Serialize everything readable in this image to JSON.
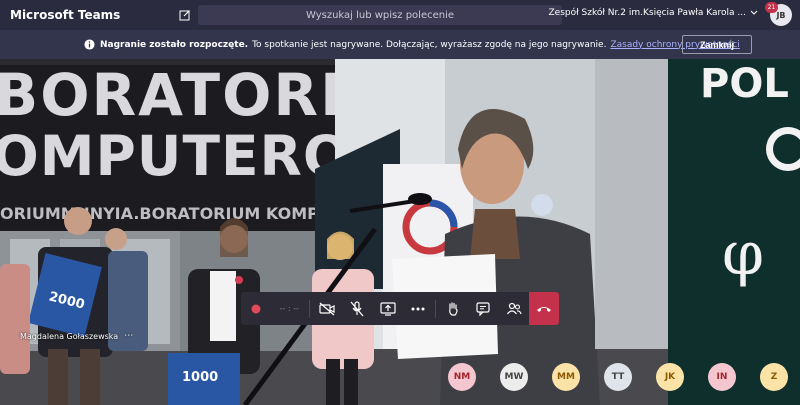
{
  "app": {
    "title": "Microsoft Teams"
  },
  "topbar": {
    "search_placeholder": "Wyszukaj lub wpisz polecenie",
    "org_name": "Zespół Szkół Nr.2 im.Księcia Pawła Karola ...",
    "notification_count": "21",
    "user_initials": "JB"
  },
  "banner": {
    "bold_text": "Nagranie zostało rozpoczęte.",
    "message": "To spotkanie jest nagrywane. Dołączając, wyrażasz zgodę na jego nagrywanie.",
    "link_text": "Zasady ochrony prywatności",
    "close_label": "Zamknij"
  },
  "video": {
    "wall_line1": "BORATORIUM",
    "wall_line2": "OMPUTEROWE",
    "wall_line3": "ORIUMMUNYIA.BORATORIUM KOMPUTEROWE  TEROWE",
    "right_banner_text": "POL",
    "speaker_name": "Magdalena Gołaszewska",
    "more_label": "⋯",
    "placard_left": "2000",
    "placard_bottom": "1000"
  },
  "controls": {
    "timer_text": "-- : --"
  },
  "participants": [
    {
      "initials": "NM",
      "bg": "#f4c6cf",
      "fg": "#a4262c"
    },
    {
      "initials": "MW",
      "bg": "#ececec",
      "fg": "#444"
    },
    {
      "initials": "MM",
      "bg": "#fbe3a8",
      "fg": "#8a5a00"
    },
    {
      "initials": "TT",
      "bg": "#dfe4ea",
      "fg": "#444"
    },
    {
      "initials": "JK",
      "bg": "#fbe3a8",
      "fg": "#8a5a00"
    },
    {
      "initials": "IN",
      "bg": "#f4c6cf",
      "fg": "#a4262c"
    },
    {
      "initials": "Z",
      "bg": "#fbe3a8",
      "fg": "#8a5a00"
    }
  ],
  "colors": {
    "topbar": "#2b2b40",
    "banner": "#33354d",
    "hangup": "#c4314b",
    "record": "#e04a5a"
  }
}
